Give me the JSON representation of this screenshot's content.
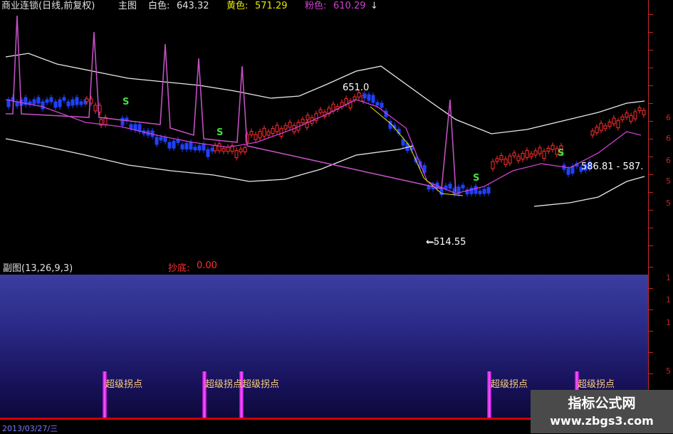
{
  "header": {
    "title": "商业连锁(日线,前复权)",
    "panel": "主图",
    "white_label": "白色:",
    "white_value": "643.32",
    "yellow_label": "黄色:",
    "yellow_value": "571.29",
    "pink_label": "粉色:",
    "pink_value": "610.29",
    "arrow": "↓"
  },
  "annotations": {
    "high": "651.0",
    "mid": "586.81 - 587.",
    "low": "←514.55",
    "signal": "S"
  },
  "sub": {
    "title": "副图(13,26,9,3)",
    "label": "抄底:",
    "value": "0.00",
    "marker_text": "超级拐点"
  },
  "axis": {
    "digits_top": [
      "6",
      "6",
      "6",
      "5",
      "5"
    ],
    "digits_bottom": [
      "1",
      "1",
      "1",
      "5"
    ]
  },
  "footer": {
    "date": "2013/03/27/三"
  },
  "watermark": {
    "line1": "指标公式网",
    "line2": "www.zbgs3.com"
  },
  "colors": {
    "white_line": "#e8e8e8",
    "yellow_line": "#e6e600",
    "pink_line": "#d040d0",
    "axis": "#c62828",
    "up_candle": "#ff3030",
    "down_candle": "#2040ff",
    "marker": "#ff60ff"
  }
}
